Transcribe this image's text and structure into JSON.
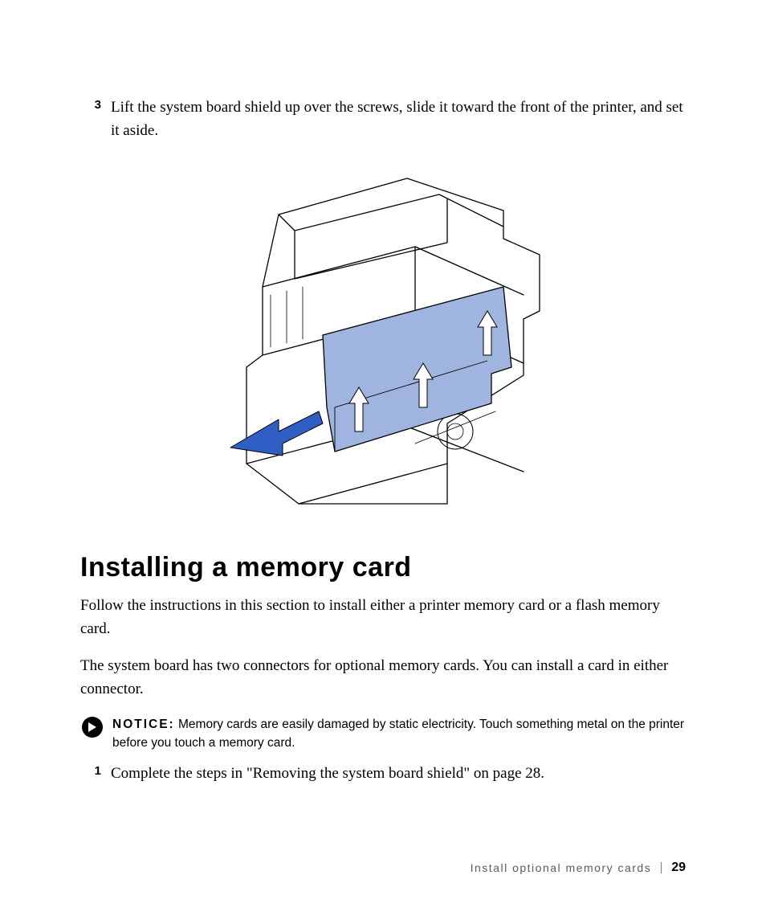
{
  "steps": {
    "top": {
      "num": "3",
      "text": "Lift the system board shield up over the screws, slide it toward the front of the printer, and set it aside."
    },
    "after_notice": {
      "num": "1",
      "text": "Complete the steps in \"Removing the system board shield\" on page 28."
    }
  },
  "section": {
    "title": "Installing a memory card",
    "p1": "Follow the instructions in this section to install either a printer memory card or a flash memory card.",
    "p2": "The system board has two connectors for optional memory cards. You can install a card in either connector."
  },
  "notice": {
    "label": "NOTICE:",
    "text": " Memory cards are easily damaged by static electricity. Touch something metal on the printer before you touch a memory card."
  },
  "footer": {
    "title": "Install optional memory cards",
    "page": "29"
  },
  "colors": {
    "arrow_white": "#ffffff",
    "arrow_blue": "#2f5fc4",
    "shield_fill": "#9fb5df",
    "line": "#000000"
  }
}
